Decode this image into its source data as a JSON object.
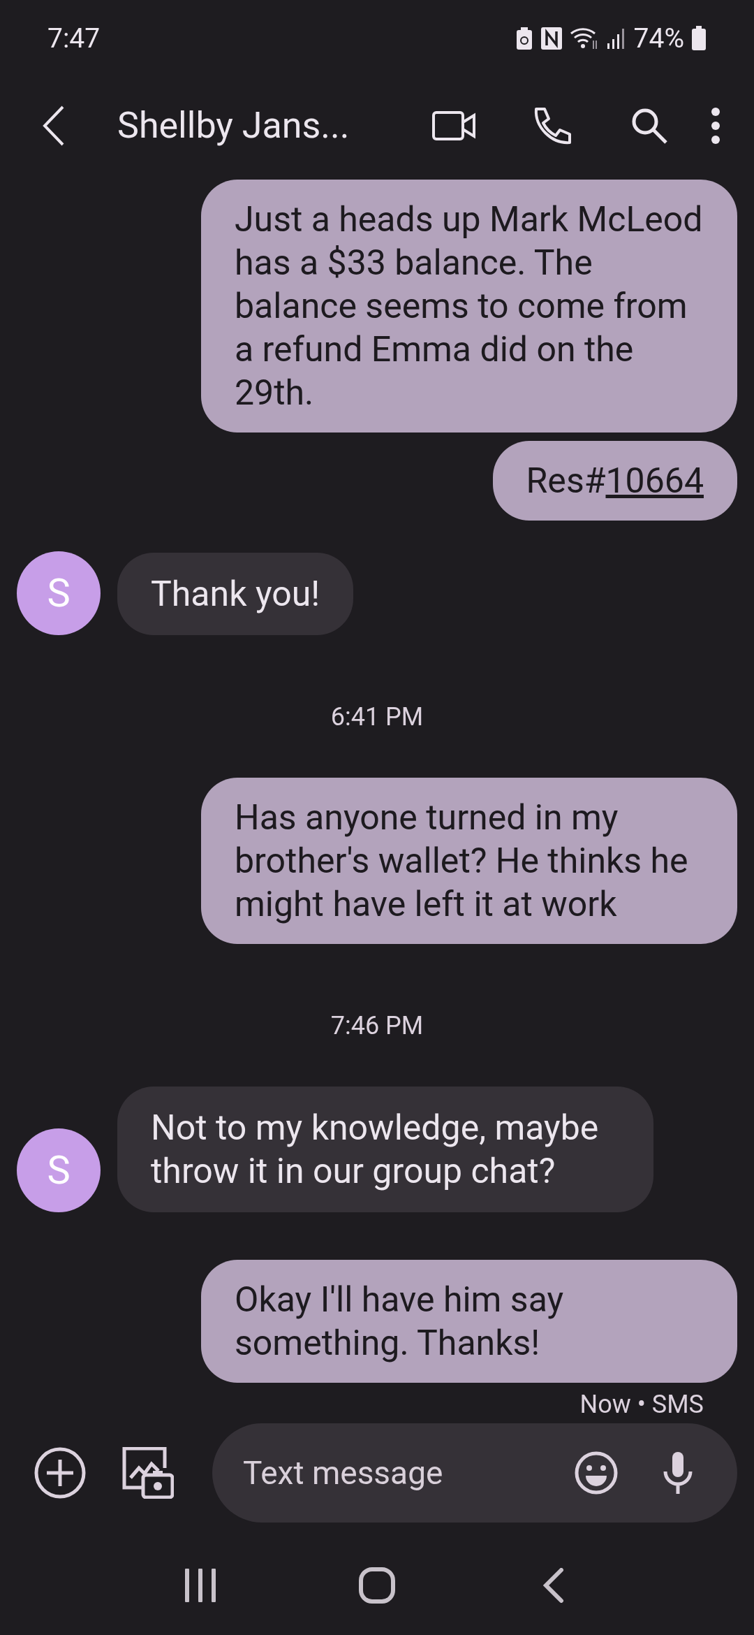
{
  "status_bar": {
    "time": "7:47",
    "battery": "74%"
  },
  "header": {
    "contact": "Shellby Jans..."
  },
  "messages": [
    {
      "kind": "sent",
      "text": "Just a heads up Mark McLeod has a $33 balance. The balance seems to come from a refund Emma did on the 29th."
    },
    {
      "kind": "sent",
      "text": "Res#",
      "link": "10664"
    },
    {
      "kind": "received",
      "avatar": "S",
      "text": "Thank you!"
    },
    {
      "kind": "time",
      "text": "6:41 PM"
    },
    {
      "kind": "sent",
      "text": "Has anyone turned in my brother's wallet? He thinks he might have left it at work"
    },
    {
      "kind": "time",
      "text": "7:46 PM"
    },
    {
      "kind": "received",
      "avatar": "S",
      "text": "Not to my knowledge, maybe throw it in our group chat?"
    },
    {
      "kind": "sent",
      "text": "Okay I'll have him say something. Thanks!",
      "meta": "Now • SMS"
    }
  ],
  "composer": {
    "placeholder": "Text message"
  }
}
